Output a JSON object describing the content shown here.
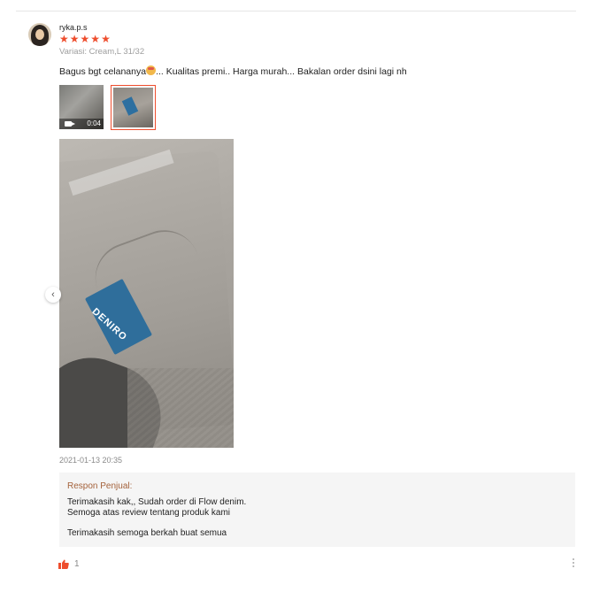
{
  "review": {
    "username": "ryka.p.s",
    "rating": 5,
    "stars": [
      "★",
      "★",
      "★",
      "★",
      "★"
    ],
    "variant": "Variasi: Cream,L 31/32",
    "comment_before_emoji": "Bagus bgt celananya",
    "comment_after_emoji": "... Kualitas premi.. Harga murah... Bakalan order dsini lagi nh",
    "media": {
      "video_duration": "0:04",
      "photo_tag_text": "DENIRO"
    },
    "timestamp": "2021-01-13 20:35"
  },
  "seller_response": {
    "title": "Respon Penjual:",
    "line1": "Terimakasih kak,, Sudah order di Flow denim.",
    "line2": "Semoga atas review tentang produk kami",
    "line3": "Terimakasih semoga berkah buat semua"
  },
  "footer": {
    "like_count": "1"
  },
  "icons": {
    "prev": "‹",
    "like": "thumbs-up-icon",
    "more": "more-vertical-icon"
  },
  "colors": {
    "accent": "#ee4d2d",
    "response_title": "#a4623b",
    "response_bg": "#f5f5f5"
  }
}
